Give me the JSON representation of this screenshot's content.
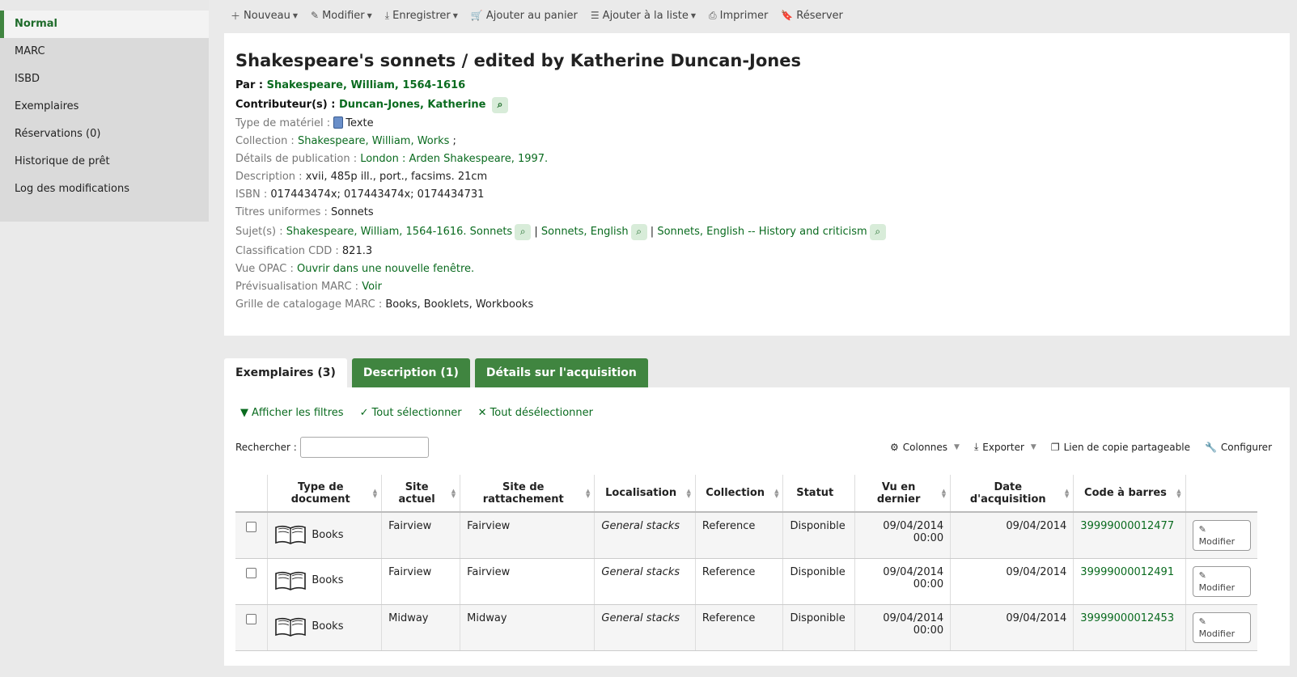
{
  "sidebar": {
    "items": [
      {
        "label": "Normal"
      },
      {
        "label": "MARC"
      },
      {
        "label": "ISBD"
      },
      {
        "label": "Exemplaires"
      },
      {
        "label": "Réservations (0)"
      },
      {
        "label": "Historique de prêt"
      },
      {
        "label": "Log des modifications"
      }
    ]
  },
  "toolbar": {
    "nouveau": "Nouveau",
    "modifier": "Modifier",
    "enregistrer": "Enregistrer",
    "panier": "Ajouter au panier",
    "liste": "Ajouter à la liste",
    "imprimer": "Imprimer",
    "reserver": "Réserver"
  },
  "record": {
    "title": "Shakespeare's sonnets / edited by Katherine Duncan-Jones",
    "par_label": "Par :",
    "par_value": "Shakespeare, William, 1564-1616",
    "contrib_label": "Contributeur(s) :",
    "contrib_value": "Duncan-Jones, Katherine",
    "type_label": "Type de matériel :",
    "type_value": "Texte",
    "collection_label": "Collection :",
    "collection_value": "Shakespeare, William, Works",
    "collection_suffix": " ;",
    "publication_label": "Détails de publication :",
    "publication_value": "London : Arden Shakespeare, 1997.",
    "description_label": "Description :",
    "description_value": "xvii, 485p ill., port., facsims. 21cm",
    "isbn_label": "ISBN :",
    "isbn_value": "017443474x; 017443474x; 0174434731",
    "uniform_label": "Titres uniformes :",
    "uniform_value": "Sonnets",
    "subjects_label": "Sujet(s) :",
    "subjects": [
      "Shakespeare, William, 1564-1616. Sonnets",
      "Sonnets, English",
      "Sonnets, English -- History and criticism"
    ],
    "separator": "|",
    "cdd_label": "Classification CDD :",
    "cdd_value": "821.3",
    "opac_label": "Vue OPAC :",
    "opac_value": "Ouvrir dans une nouvelle fenêtre.",
    "marc_preview_label": "Prévisualisation MARC :",
    "marc_preview_value": "Voir",
    "framework_label": "Grille de catalogage MARC :",
    "framework_value": "Books, Booklets, Workbooks"
  },
  "tabs": [
    {
      "label": "Exemplaires (3)"
    },
    {
      "label": "Description (1)"
    },
    {
      "label": "Détails sur l'acquisition"
    }
  ],
  "items": {
    "actions": {
      "filters": "Afficher les filtres",
      "select_all": "Tout sélectionner",
      "deselect_all": "Tout désélectionner"
    },
    "search_label": "Rechercher :",
    "tools": {
      "columns": "Colonnes",
      "export": "Exporter",
      "copy_link": "Lien de copie partageable",
      "configure": "Configurer"
    },
    "headers": {
      "itype": "Type de document",
      "current_site": "Site actuel",
      "home_site": "Site de rattachement",
      "location": "Localisation",
      "collection": "Collection",
      "status": "Statut",
      "last_seen": "Vu en dernier",
      "acquired": "Date d'acquisition",
      "barcode": "Code à barres"
    },
    "edit_label": "Modifier",
    "rows": [
      {
        "itype": "Books",
        "current": "Fairview",
        "home": "Fairview",
        "location": "General stacks",
        "collection": "Reference",
        "status": "Disponible",
        "last_seen_date": "09/04/2014",
        "last_seen_time": "00:00",
        "acquired": "09/04/2014",
        "barcode": "39999000012477"
      },
      {
        "itype": "Books",
        "current": "Fairview",
        "home": "Fairview",
        "location": "General stacks",
        "collection": "Reference",
        "status": "Disponible",
        "last_seen_date": "09/04/2014",
        "last_seen_time": "00:00",
        "acquired": "09/04/2014",
        "barcode": "39999000012491"
      },
      {
        "itype": "Books",
        "current": "Midway",
        "home": "Midway",
        "location": "General stacks",
        "collection": "Reference",
        "status": "Disponible",
        "last_seen_date": "09/04/2014",
        "last_seen_time": "00:00",
        "acquired": "09/04/2014",
        "barcode": "39999000012453"
      }
    ]
  },
  "colors": {
    "accent": "#408540",
    "link": "#0a6b1f"
  }
}
